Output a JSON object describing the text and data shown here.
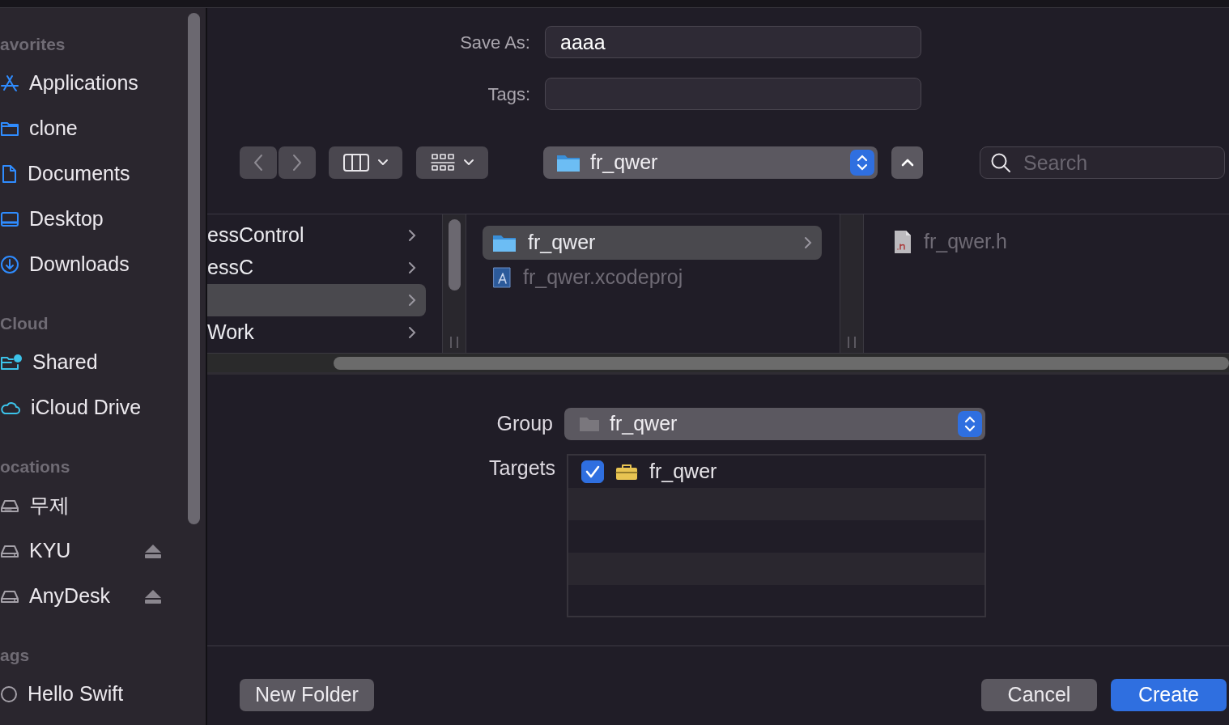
{
  "sidebar": {
    "sections": [
      {
        "title": "avorites",
        "items": [
          {
            "label": "Applications",
            "kind": "apps",
            "eject": false
          },
          {
            "label": "clone",
            "kind": "folder",
            "eject": false
          },
          {
            "label": "Documents",
            "kind": "doc",
            "eject": false
          },
          {
            "label": "Desktop",
            "kind": "desktop",
            "eject": false
          },
          {
            "label": "Downloads",
            "kind": "download",
            "eject": false
          }
        ]
      },
      {
        "title": "Cloud",
        "items": [
          {
            "label": "Shared",
            "kind": "shared",
            "eject": false
          },
          {
            "label": "iCloud Drive",
            "kind": "cloud",
            "eject": false
          }
        ]
      },
      {
        "title": "ocations",
        "items": [
          {
            "label": "무제",
            "kind": "disk",
            "eject": false
          },
          {
            "label": "KYU",
            "kind": "drive",
            "eject": true
          },
          {
            "label": "AnyDesk",
            "kind": "drive",
            "eject": true
          }
        ]
      },
      {
        "title": "ags",
        "items": [
          {
            "label": "Hello Swift",
            "kind": "tag",
            "eject": false
          }
        ]
      }
    ]
  },
  "save_as": {
    "label": "Save As:",
    "value": "aaaa"
  },
  "tags": {
    "label": "Tags:"
  },
  "toolbar": {
    "path": "fr_qwer",
    "search": {
      "placeholder": "Search"
    }
  },
  "browser": {
    "columns": [
      {
        "rows": [
          {
            "label": "essControl",
            "selected": false,
            "has_children": true,
            "dimmed": false
          },
          {
            "label": "essC",
            "selected": false,
            "has_children": true,
            "dimmed": false
          },
          {
            "selected": true,
            "has_children": true,
            "dimmed": false
          },
          {
            "label": "Work",
            "selected": false,
            "has_children": true,
            "dimmed": false
          }
        ]
      },
      {
        "rows": [
          {
            "label": "fr_qwer",
            "kind": "folder",
            "selected": true,
            "has_children": true,
            "dimmed": false
          },
          {
            "label": "fr_qwer.xcodeproj",
            "kind": "project",
            "selected": false,
            "has_children": false,
            "dimmed": true
          }
        ]
      },
      {
        "rows": [
          {
            "label": "fr_qwer.h",
            "kind": "header",
            "selected": false,
            "has_children": false,
            "dimmed": true
          }
        ]
      }
    ]
  },
  "group": {
    "label": "Group",
    "value": "fr_qwer"
  },
  "targets": {
    "label": "Targets",
    "items": [
      {
        "label": "fr_qwer",
        "checked": true
      }
    ]
  },
  "buttons": [
    {
      "label": "New Folder",
      "kind": "default"
    },
    {
      "label": "Cancel",
      "kind": "default"
    },
    {
      "label": "Create",
      "kind": "primary"
    }
  ]
}
